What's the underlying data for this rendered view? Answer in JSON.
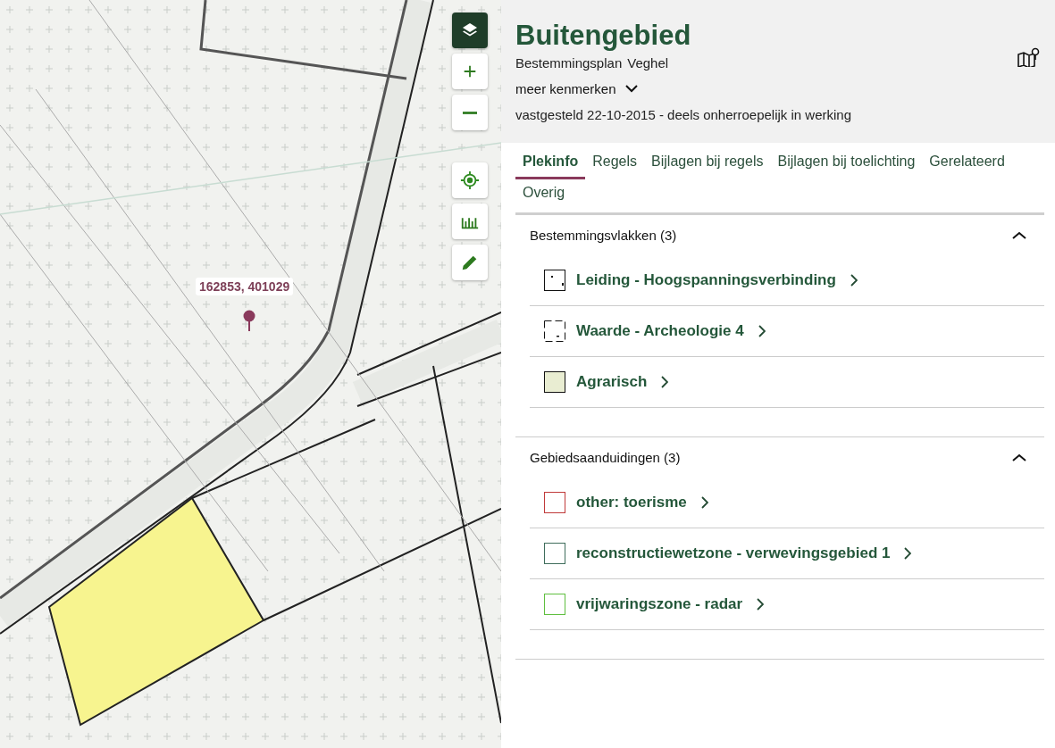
{
  "map": {
    "coordinates": "162853, 401029"
  },
  "map_controls": [
    {
      "kind": "layers",
      "selected": true
    },
    {
      "kind": "zoom-in",
      "selected": false
    },
    {
      "kind": "zoom-out",
      "selected": false
    },
    {
      "kind": "locate",
      "selected": false
    },
    {
      "kind": "measure",
      "selected": false
    },
    {
      "kind": "draw",
      "selected": false
    }
  ],
  "plan": {
    "title": "Buitengebied",
    "type": "Bestemmingsplan",
    "place": "Veghel",
    "more": "meer kenmerken",
    "status": "vastgesteld 22-10-2015 - deels onherroepelijk in werking"
  },
  "tabs": [
    {
      "label": "Plekinfo",
      "selected": true
    },
    {
      "label": "Regels",
      "selected": false
    },
    {
      "label": "Bijlagen bij regels",
      "selected": false
    },
    {
      "label": "Bijlagen bij toelichting",
      "selected": false
    },
    {
      "label": "Gerelateerd",
      "selected": false
    },
    {
      "label": "Overig",
      "selected": false
    }
  ],
  "sections": [
    {
      "title": "Bestemmingsvlakken (3)",
      "expanded": true,
      "items": [
        {
          "label": "Leiding - Hoogspanningsverbinding",
          "kind": "dots",
          "color": "#111111"
        },
        {
          "label": "Waarde - Archeologie 4",
          "kind": "dashes",
          "color": "#111111"
        },
        {
          "label": "Agrarisch",
          "kind": "fill",
          "color": "#e9edd2"
        }
      ]
    },
    {
      "title": "Gebiedsaanduidingen (3)",
      "expanded": true,
      "items": [
        {
          "label": "other: toerisme",
          "kind": "outline",
          "color": "#c03a3a"
        },
        {
          "label": "reconstructiewetzone - verwevingsgebied 1",
          "kind": "outline",
          "color": "#3f6d5c"
        },
        {
          "label": "vrijwaringszone - radar",
          "kind": "outline",
          "color": "#5fbf3f"
        }
      ]
    }
  ]
}
